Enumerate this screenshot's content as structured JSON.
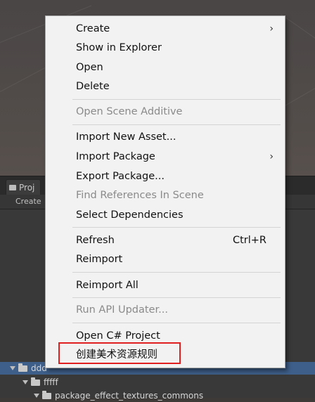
{
  "project_panel": {
    "tab_label": "Proj",
    "toolbar_create": "Create",
    "tree": [
      {
        "label": "ddd",
        "selected": true
      },
      {
        "label": "fffff",
        "selected": false
      },
      {
        "label": "package_effect_textures_commons",
        "selected": false
      }
    ]
  },
  "context_menu": {
    "items": [
      {
        "label": "Create",
        "enabled": true,
        "submenu": true
      },
      {
        "label": "Show in Explorer",
        "enabled": true
      },
      {
        "label": "Open",
        "enabled": true
      },
      {
        "label": "Delete",
        "enabled": true
      },
      {
        "label": "Open Scene Additive",
        "enabled": false
      },
      {
        "label": "Import New Asset...",
        "enabled": true
      },
      {
        "label": "Import Package",
        "enabled": true,
        "submenu": true
      },
      {
        "label": "Export Package...",
        "enabled": true
      },
      {
        "label": "Find References In Scene",
        "enabled": false
      },
      {
        "label": "Select Dependencies",
        "enabled": true
      },
      {
        "label": "Refresh",
        "enabled": true,
        "shortcut": "Ctrl+R"
      },
      {
        "label": "Reimport",
        "enabled": true
      },
      {
        "label": "Reimport All",
        "enabled": true
      },
      {
        "label": "Run API Updater...",
        "enabled": false
      },
      {
        "label": "Open C# Project",
        "enabled": true
      },
      {
        "label": "创建美术资源规则",
        "enabled": true,
        "highlighted": true
      }
    ],
    "submenu_arrow_glyph": "›"
  },
  "colors": {
    "highlight_border": "#e02020",
    "selection": "#3e5f8a"
  }
}
